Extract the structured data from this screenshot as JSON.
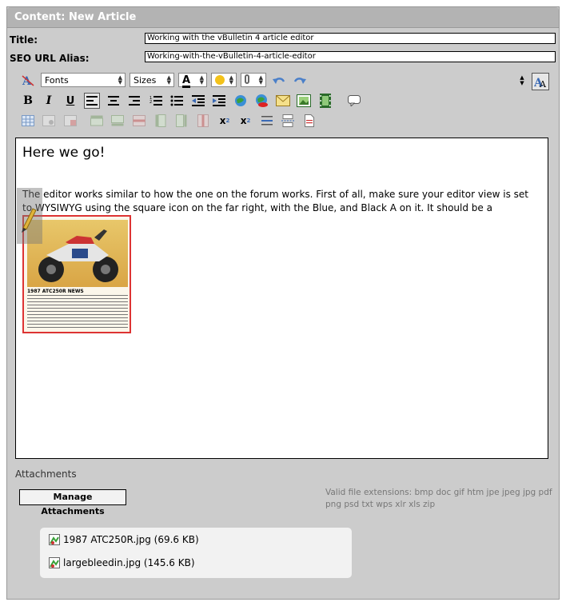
{
  "panel": {
    "title": "Content: New Article"
  },
  "form": {
    "title_label": "Title:",
    "title_value": "Working with the vBulletin 4 article editor",
    "seo_label": "SEO URL Alias:",
    "seo_value": "Working-with-the-vBulletin-4-article-editor"
  },
  "toolbar": {
    "font_select": "Fonts",
    "size_select": "Sizes",
    "text_color_glyph": "A",
    "bold": "B",
    "italic": "I",
    "underline": "U",
    "subscript": "x",
    "subscript_small": "2",
    "superscript": "x",
    "superscript_small": "2"
  },
  "editor": {
    "heading": "Here we go!",
    "paragraph": "The editor works similar to how the one on the forum works. First of all, make sure your editor view is set to WYSIWYG using the square icon on the far right, with the Blue, and Black A on it. It should be a",
    "image_caption": "1987 ATC250R NEWS"
  },
  "attachments": {
    "label": "Attachments",
    "manage_button": "Manage Attachments",
    "valid_extensions": "Valid file extensions: bmp doc gif htm jpe jpeg jpg pdf png psd txt wps xlr xls zip",
    "files": [
      {
        "name": "1987 ATC250R.jpg (69.6 KB)"
      },
      {
        "name": "largebleedin.jpg (145.6 KB)"
      }
    ]
  },
  "colors": {
    "panel_bg": "#cccccc",
    "header_bg": "#b3b3b3",
    "accent_blue": "#3a6ab5",
    "image_border": "#dd3333"
  }
}
